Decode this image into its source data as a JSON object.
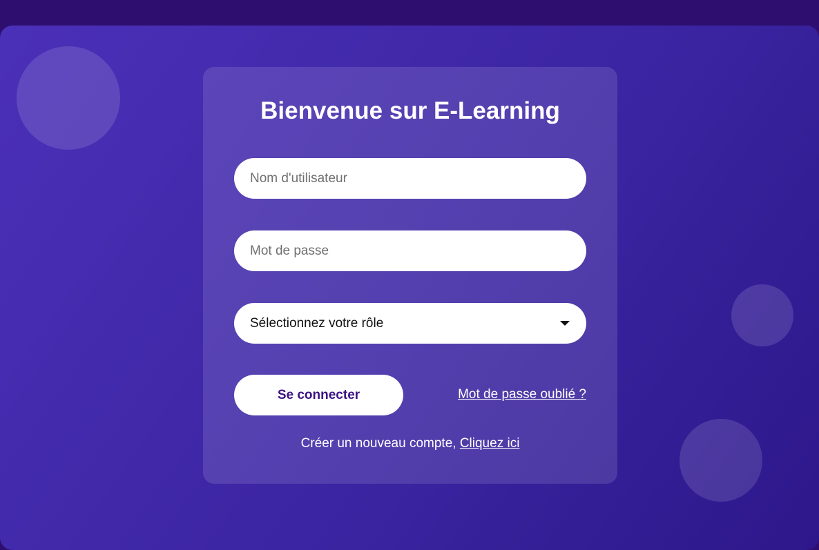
{
  "colors": {
    "background_top": "#2e0f70",
    "gradient_start": "#4b30b8",
    "gradient_end": "#2d178a",
    "button_text": "#3c1283"
  },
  "login": {
    "title": "Bienvenue sur E-Learning",
    "username": {
      "placeholder": "Nom d'utilisateur",
      "value": ""
    },
    "password": {
      "placeholder": "Mot de passe",
      "value": ""
    },
    "role": {
      "selected": "Sélectionnez votre rôle",
      "icon": "caret-down-icon"
    },
    "submit_label": "Se connecter",
    "forgot_label": "Mot de passe oublié ?",
    "signup_text": "Créer un nouveau compte, ",
    "signup_link": "Cliquez ici"
  }
}
